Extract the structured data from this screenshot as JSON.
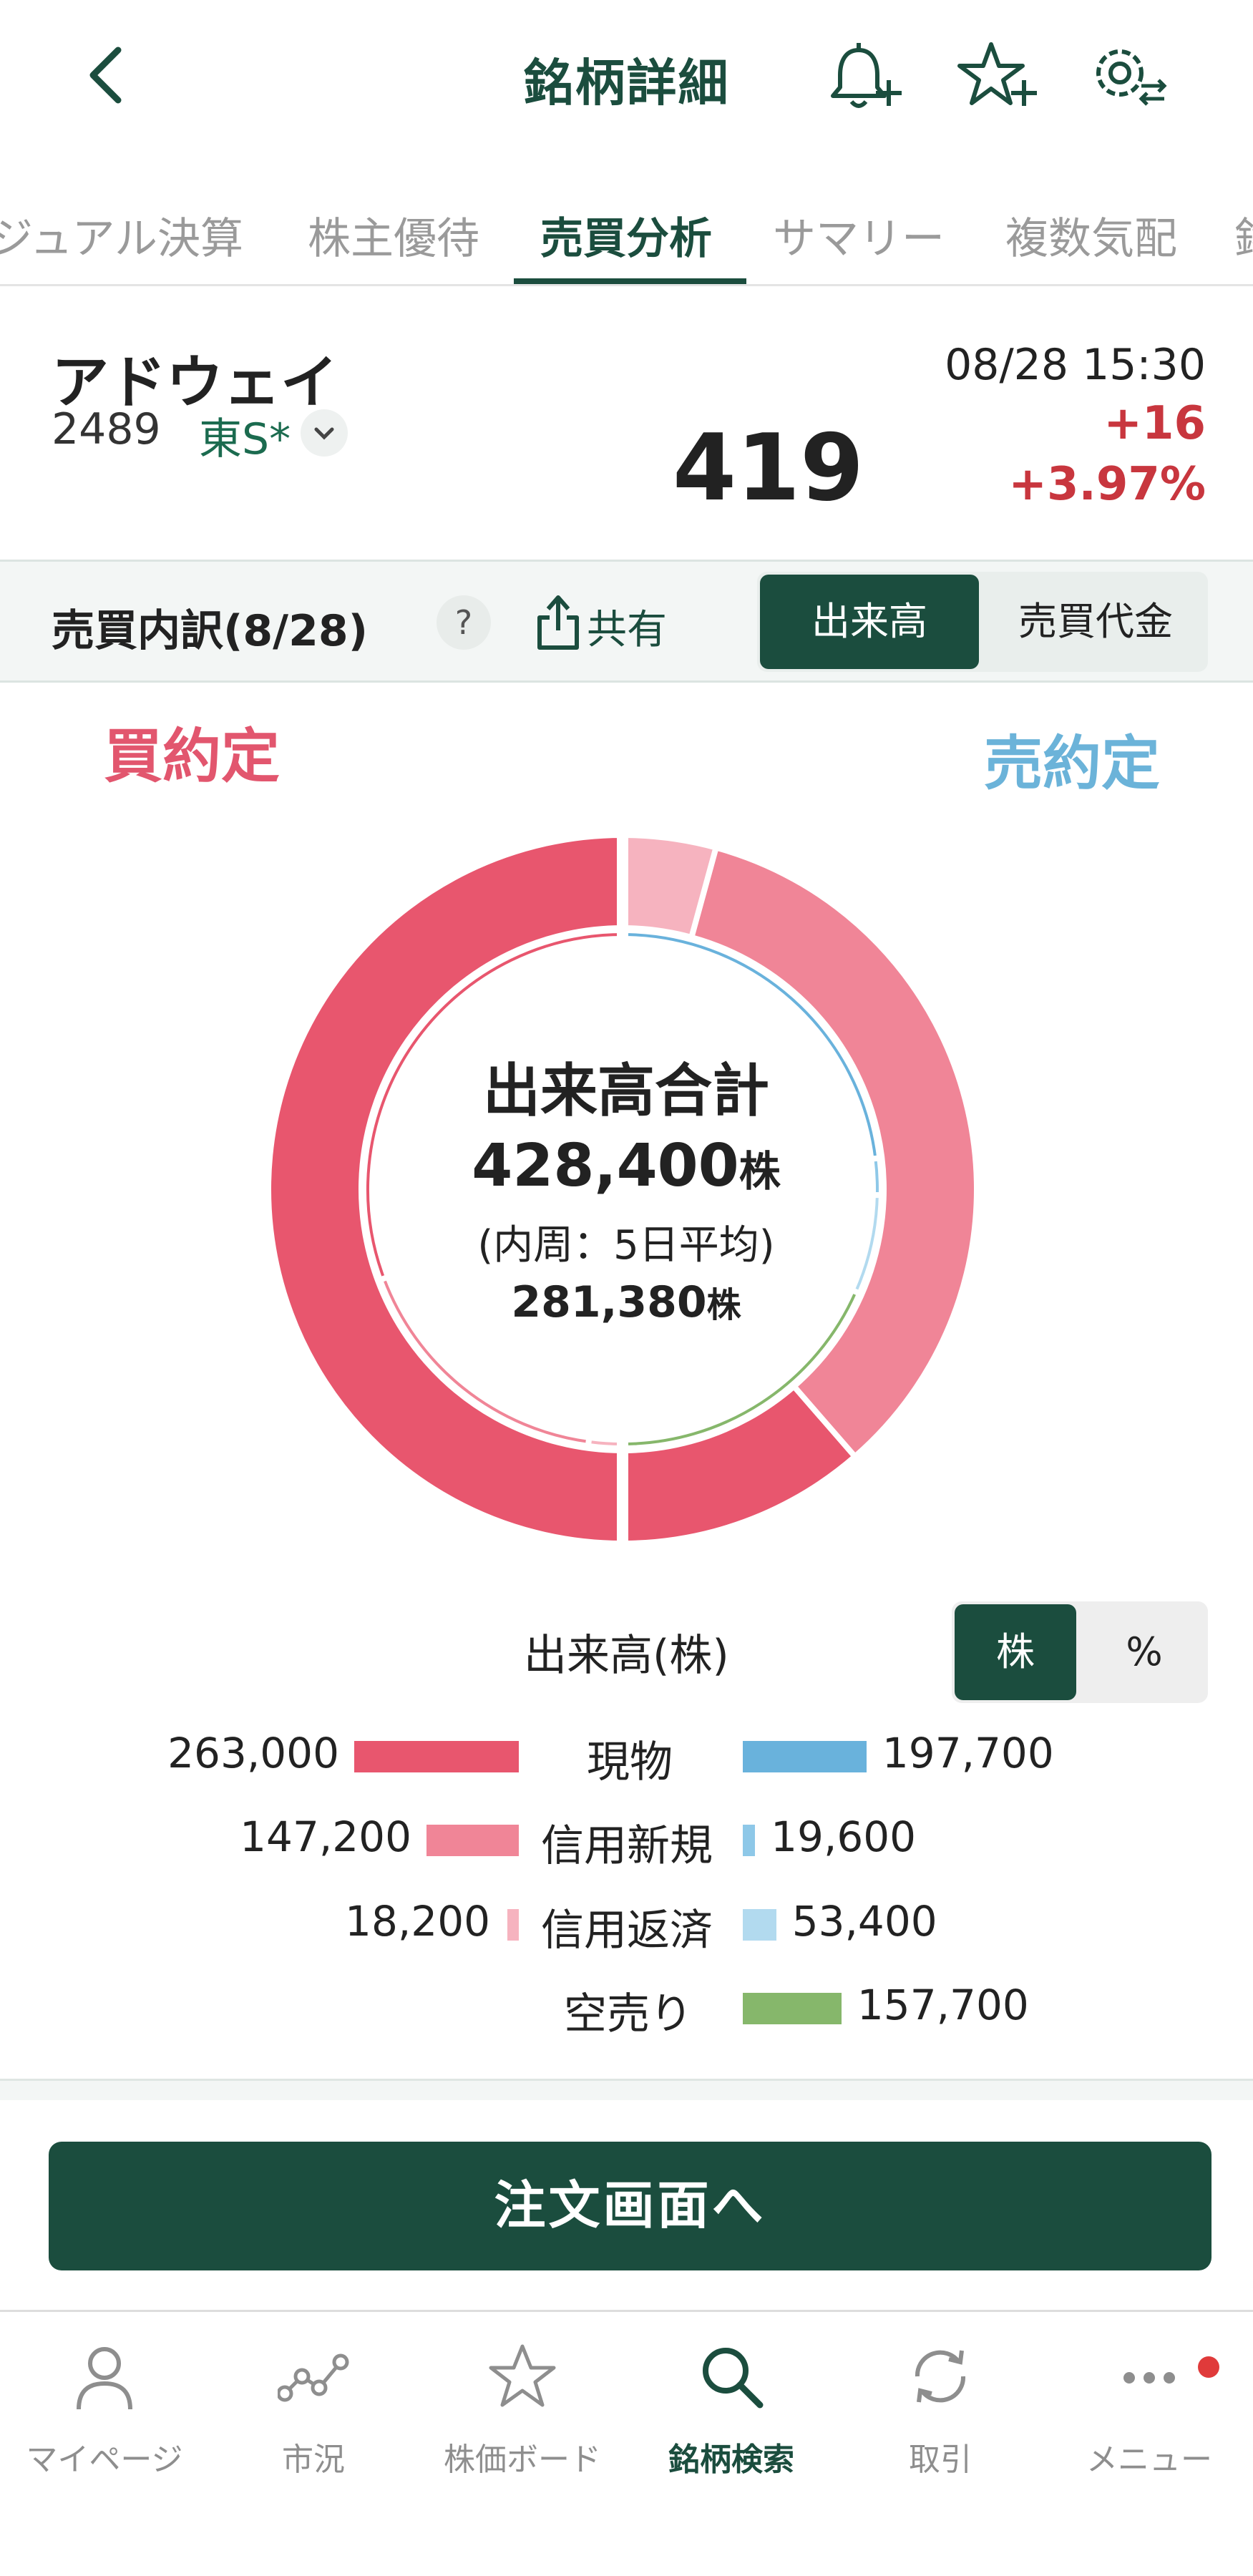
{
  "header": {
    "title": "銘柄詳細"
  },
  "tabs": [
    {
      "label": "ジュアル決算",
      "active": false
    },
    {
      "label": "株主優待",
      "active": false
    },
    {
      "label": "売買分析",
      "active": true
    },
    {
      "label": "サマリー",
      "active": false
    },
    {
      "label": "複数気配",
      "active": false
    },
    {
      "label": "銘",
      "active": false
    }
  ],
  "stock": {
    "name": "アドウェイ",
    "code": "2489",
    "market": "東S*",
    "datetime": "08/28 15:30",
    "price": "419",
    "change": "+16",
    "change_pct": "+3.97%"
  },
  "breakdown": {
    "title": "売買内訳(8/28)",
    "help": "?",
    "share_label": "共有",
    "toggle": {
      "selected": "出来高",
      "other": "売買代金"
    }
  },
  "labels": {
    "buy": "買約定",
    "sell": "売約定"
  },
  "center": {
    "title": "出来高合計",
    "total": "428,400",
    "unit": "株",
    "inner_caption": "(内周：5日平均)",
    "avg": "281,380"
  },
  "legend": {
    "title": "出来高(株)",
    "unit_toggle": {
      "selected": "株",
      "other": "%"
    },
    "rows": [
      {
        "label": "現物",
        "buy": "263,000",
        "sell": "197,700"
      },
      {
        "label": "信用新規",
        "buy": "147,200",
        "sell": "19,600"
      },
      {
        "label": "信用返済",
        "buy": "18,200",
        "sell": "53,400"
      },
      {
        "label": "空売り",
        "buy": "",
        "sell": "157,700"
      }
    ]
  },
  "chart_data": {
    "type": "pie",
    "title": "出来高合計",
    "unit": "株",
    "total": 428400,
    "inner_ring_total": 281380,
    "categories": [
      "現物",
      "信用新規",
      "信用返済",
      "空売り"
    ],
    "series": [
      {
        "name": "買約定",
        "values": [
          263000,
          147200,
          18200,
          0
        ]
      },
      {
        "name": "売約定",
        "values": [
          197700,
          19600,
          53400,
          157700
        ]
      }
    ],
    "colors": {
      "buy": [
        "#e8566e",
        "#f08597",
        "#f6b3bf"
      ],
      "sell": [
        "#69b2dc",
        "#8ec8e8",
        "#b2daef",
        "#86b76b"
      ]
    }
  },
  "order_button": {
    "label": "注文画面へ"
  },
  "tabbar": {
    "items": [
      {
        "label": "マイページ",
        "icon": "person-icon",
        "active": false
      },
      {
        "label": "市況",
        "icon": "market-chart-icon",
        "active": false
      },
      {
        "label": "株価ボード",
        "icon": "star-icon",
        "active": false
      },
      {
        "label": "銘柄検索",
        "icon": "search-icon",
        "active": true
      },
      {
        "label": "取引",
        "icon": "refresh-icon",
        "active": false
      },
      {
        "label": "メニュー",
        "icon": "more-icon",
        "active": false
      }
    ]
  },
  "theme": {
    "accent": "#1b4d3e",
    "up": "#c8363e"
  }
}
